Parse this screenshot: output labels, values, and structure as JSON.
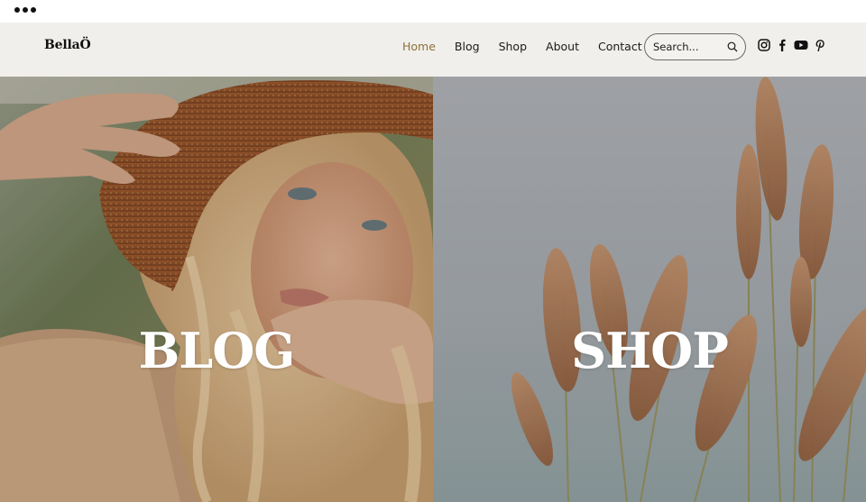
{
  "browser": {
    "menu_icon": "more-dots-icon"
  },
  "header": {
    "logo": "BellaÖ",
    "nav": [
      {
        "label": "Home",
        "active": true
      },
      {
        "label": "Blog",
        "active": false
      },
      {
        "label": "Shop",
        "active": false
      },
      {
        "label": "About",
        "active": false
      },
      {
        "label": "Contact",
        "active": false
      }
    ],
    "search": {
      "placeholder": "Search...",
      "value": ""
    },
    "socials": [
      "instagram-icon",
      "facebook-icon",
      "youtube-icon",
      "pinterest-icon"
    ]
  },
  "panels": [
    {
      "label": "BLOG",
      "image": "woman-in-straw-hat"
    },
    {
      "label": "SHOP",
      "image": "pampas-grass-by-sea"
    }
  ],
  "colors": {
    "header_bg": "#f1efeb",
    "nav_active": "#8a7338",
    "text": "#1a1a1a"
  }
}
